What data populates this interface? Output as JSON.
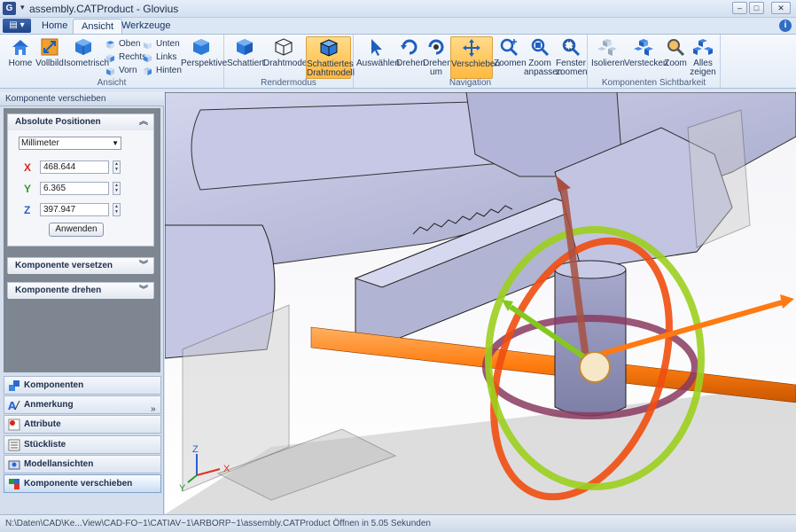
{
  "window": {
    "title": "assembly.CATProduct - Glovius",
    "app_letter": "G",
    "minimize": "–",
    "maximize": "□",
    "close": "✕"
  },
  "tabs": {
    "home": "Home",
    "ansicht": "Ansicht",
    "werkzeuge": "Werkzeuge"
  },
  "ribbon": {
    "ansicht": {
      "label": "Ansicht",
      "home": "Home",
      "vollbild": "Vollbild",
      "isometrisch": "Isometrisch",
      "oben": "Oben",
      "rechts": "Rechts",
      "vorn": "Vorn",
      "unten": "Unten",
      "links": "Links",
      "hinten": "Hinten",
      "perspektive": "Perspektive"
    },
    "rendermodus": {
      "label": "Rendermodus",
      "schattiert": "Schattiert",
      "drahtmodell": "Drahtmodell",
      "schattiertes_l1": "Schattiertes",
      "schattiertes_l2": "Drahtmodell"
    },
    "navigation": {
      "label": "Navigation",
      "auswaehlen": "Auswählen",
      "drehen": "Drehen",
      "drehen_um_l1": "Drehen",
      "drehen_um_l2": "um",
      "verschieben": "Verschieben",
      "zoomen": "Zoomen",
      "zoom_anpassen_l1": "Zoom",
      "zoom_anpassen_l2": "anpassen",
      "fenster_zoomen_l1": "Fenster",
      "fenster_zoomen_l2": "zoomen"
    },
    "sichtbarkeit": {
      "label": "Komponenten Sichtbarkeit",
      "isolieren": "Isolieren",
      "verstecken": "Verstecken",
      "zoom": "Zoom",
      "alles_zeigen_l1": "Alles",
      "alles_zeigen_l2": "zeigen"
    }
  },
  "panel": {
    "header": "Komponente verschieben",
    "absolute": {
      "title": "Absolute Positionen",
      "unit": "Millimeter",
      "x_label": "X",
      "y_label": "Y",
      "z_label": "Z",
      "x_value": "468.644",
      "y_value": "6.365",
      "z_value": "397.947",
      "apply": "Anwenden"
    },
    "versetzen": "Komponente versetzen",
    "drehen": "Komponente drehen"
  },
  "nav": {
    "komponenten": "Komponenten",
    "anmerkung": "Anmerkung",
    "attribute": "Attribute",
    "stueckliste": "Stückliste",
    "modellansichten": "Modellansichten",
    "verschieben": "Komponente verschieben",
    "more": "»"
  },
  "axes": {
    "x": "X",
    "y": "Y",
    "z": "Z"
  },
  "colors": {
    "accent": "#ffb940",
    "x_axis": "#e0301e",
    "y_axis": "#2a9a2a",
    "z_axis": "#2b5fcf"
  },
  "status": "N:\\Daten\\CAD\\Ke...View\\CAD-FO~1\\CATIAV~1\\ARBORP~1\\assembly.CATProduct Öffnen in 5.05 Sekunden"
}
